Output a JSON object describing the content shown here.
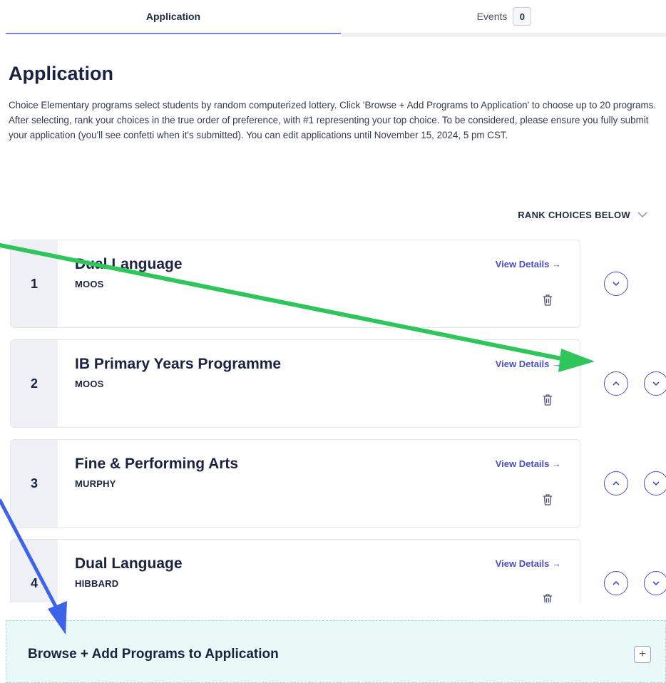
{
  "tabs": {
    "application": "Application",
    "events": "Events",
    "events_count": "0"
  },
  "page": {
    "title": "Application",
    "intro": "Choice Elementary programs select students by random computerized lottery. Click 'Browse + Add Programs to Application' to choose up to 20 programs. After selecting, rank your choices in the true order of preference, with #1 representing your top choice. To be considered, please ensure you fully submit your application (you'll see confetti when it's submitted). You can edit applications until November 15, 2024, 5 pm CST.",
    "rank_header": "RANK CHOICES BELOW"
  },
  "choices": [
    {
      "rank": "1",
      "program": "Dual Language",
      "school": "MOOS",
      "details": "View Details →"
    },
    {
      "rank": "2",
      "program": "IB Primary Years Programme",
      "school": "MOOS",
      "details": "View Details →"
    },
    {
      "rank": "3",
      "program": "Fine & Performing Arts",
      "school": "MURPHY",
      "details": "View Details →"
    },
    {
      "rank": "4",
      "program": "Dual Language",
      "school": "HIBBARD",
      "details": "View Details →"
    }
  ],
  "browse": {
    "label": "Browse + Add Programs to Application",
    "plus": "+"
  },
  "colors": {
    "accent": "#4a4fc4",
    "green_arrow": "#2ec55a",
    "blue_arrow": "#3d63e8",
    "browse_bg": "#e8f9f8"
  }
}
